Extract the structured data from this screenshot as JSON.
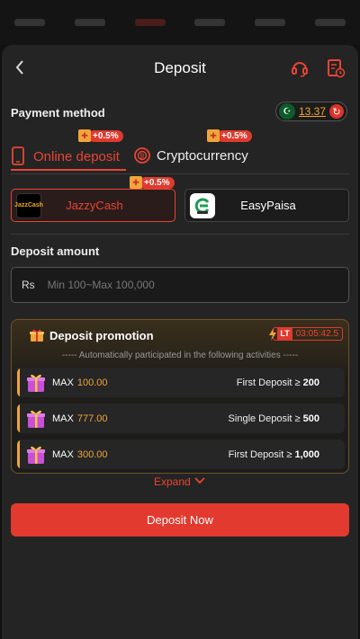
{
  "header": {
    "title": "Deposit"
  },
  "payment": {
    "label": "Payment method",
    "balance": "13.37"
  },
  "tabs": [
    {
      "label": "Online deposit",
      "bonus": "+0.5%"
    },
    {
      "label": "Cryptocurrency",
      "bonus": "+0.5%"
    }
  ],
  "methods": [
    {
      "label": "JazzyCash",
      "bonus": "+0.5%",
      "logo_text": "JazzCash"
    },
    {
      "label": "EasyPaisa"
    }
  ],
  "amount": {
    "label": "Deposit amount",
    "currency": "Rs",
    "placeholder": "Min 100~Max 100,000"
  },
  "promotion": {
    "title": "Deposit promotion",
    "timer_badge": "LT",
    "timer": "03:05:42.5",
    "subtitle": "----- Automatically participated in the following activities -----",
    "items": [
      {
        "max_label": "MAX",
        "amount": "100.00",
        "condition": "First Deposit ≥",
        "threshold": "200"
      },
      {
        "max_label": "MAX",
        "amount": "777.00",
        "condition": "Single Deposit ≥",
        "threshold": "500"
      },
      {
        "max_label": "MAX",
        "amount": "300.00",
        "condition": "First Deposit ≥",
        "threshold": "1,000"
      }
    ]
  },
  "expand": "Expand",
  "deposit_button": "Deposit Now",
  "colors": {
    "accent": "#e94534",
    "gold": "#f0a53a",
    "background": "#242424"
  }
}
